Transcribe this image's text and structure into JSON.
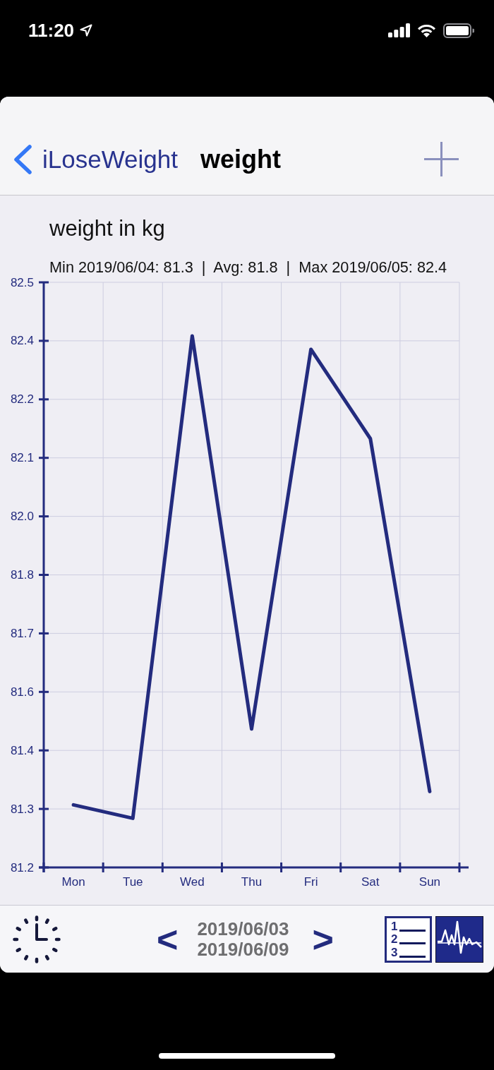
{
  "status_bar": {
    "time": "11:20"
  },
  "nav_bar": {
    "back_label": "iLoseWeight",
    "title": "weight"
  },
  "chart_panel": {
    "stats": "Min 2019/06/04: 81.3  |  Avg: 81.8  |  Max 2019/06/05: 82.4",
    "chart_data": {
      "type": "line",
      "title": "weight in kg",
      "grid": true,
      "categories": [
        "Mon",
        "Tue",
        "Wed",
        "Thu",
        "Fri",
        "Sat",
        "Sun"
      ],
      "series": [
        {
          "color": "#232b7e",
          "values": [
            81.32,
            81.29,
            82.37,
            81.49,
            82.34,
            82.14,
            81.35
          ]
        }
      ],
      "ylim": [
        81.18,
        82.49
      ],
      "yticks": [
        {
          "value": 81.18,
          "label": "81.2"
        },
        {
          "value": 81.311,
          "label": "81.3"
        },
        {
          "value": 81.442,
          "label": "81.4"
        },
        {
          "value": 81.573,
          "label": "81.6"
        },
        {
          "value": 81.704,
          "label": "81.7"
        },
        {
          "value": 81.835,
          "label": "81.8"
        },
        {
          "value": 81.966,
          "label": "82.0"
        },
        {
          "value": 82.097,
          "label": "82.1"
        },
        {
          "value": 82.228,
          "label": "82.2"
        },
        {
          "value": 82.359,
          "label": "82.4"
        },
        {
          "value": 82.49,
          "label": "82.5"
        }
      ]
    }
  },
  "toolbar": {
    "previous": "<",
    "date_range": [
      "2019/06/03",
      "2019/06/09"
    ],
    "next": ">",
    "list_numbers": [
      "1",
      "2",
      "3"
    ]
  }
}
